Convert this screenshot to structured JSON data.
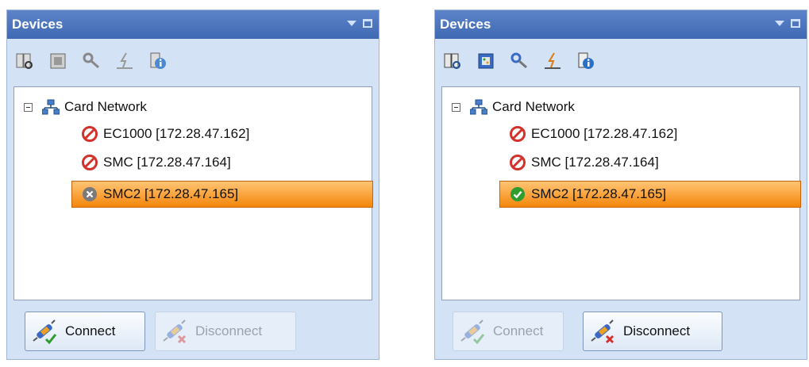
{
  "panels": [
    {
      "title": "Devices",
      "tree": {
        "root_label": "Card Network",
        "devices": [
          {
            "label": "EC1000 [172.28.47.162]",
            "status": "blocked-icon",
            "selected": false
          },
          {
            "label": "SMC [172.28.47.164]",
            "status": "blocked-icon",
            "selected": false
          },
          {
            "label": "SMC2 [172.28.47.165]",
            "status": "disconnected-icon",
            "selected": true
          }
        ]
      },
      "buttons": {
        "connect_label": "Connect",
        "connect_enabled": true,
        "disconnect_label": "Disconnect",
        "disconnect_enabled": false
      }
    },
    {
      "title": "Devices",
      "tree": {
        "root_label": "Card Network",
        "devices": [
          {
            "label": "EC1000 [172.28.47.162]",
            "status": "blocked-icon",
            "selected": false
          },
          {
            "label": "SMC [172.28.47.164]",
            "status": "blocked-icon",
            "selected": false
          },
          {
            "label": "SMC2 [172.28.47.165]",
            "status": "connected-icon",
            "selected": true
          }
        ]
      },
      "buttons": {
        "connect_label": "Connect",
        "connect_enabled": false,
        "disconnect_label": "Disconnect",
        "disconnect_enabled": true
      }
    }
  ],
  "colors": {
    "title_bar": "#4a73be",
    "panel_bg": "#d3e2f5",
    "selection": "#f4860b",
    "blocked": "#d4312b",
    "connected": "#2e9c2f",
    "disconnected": "#7a7a7a"
  }
}
